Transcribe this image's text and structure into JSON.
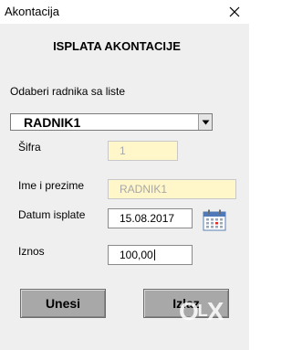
{
  "window": {
    "title": "Akontacija"
  },
  "form": {
    "heading": "ISPLATA AKONTACIJE",
    "select_prompt": "Odaberi radnika sa liste",
    "employee_selected": "RADNIK1",
    "fields": {
      "sifra": {
        "label": "Šifra",
        "value": "1"
      },
      "ime": {
        "label": "Ime i prezime",
        "value": "RADNIK1"
      },
      "datum": {
        "label": "Datum isplate",
        "value": "15.08.2017"
      },
      "iznos": {
        "label": "Iznos",
        "value": "100,00"
      }
    },
    "buttons": {
      "submit": "Unesi",
      "exit": "Izlaz"
    }
  },
  "watermark": "OLX",
  "icons": [
    "close-icon",
    "dropdown-arrow-icon",
    "calendar-icon"
  ],
  "colors": {
    "readonly_field": "#fff7c9",
    "button": "#a8a8a8",
    "background": "#efefef"
  }
}
